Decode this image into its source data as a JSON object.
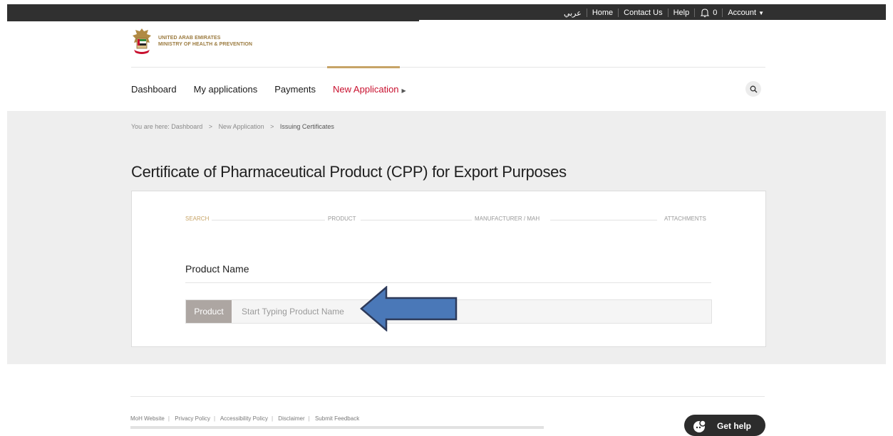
{
  "topbar": {
    "arabic": "عربي",
    "home": "Home",
    "contact": "Contact Us",
    "help": "Help",
    "notifications_count": "0",
    "account": "Account"
  },
  "logo": {
    "line1": "UNITED ARAB EMIRATES",
    "line2": "MINISTRY OF HEALTH & PREVENTION"
  },
  "nav": {
    "items": [
      {
        "label": "Dashboard"
      },
      {
        "label": "My applications"
      },
      {
        "label": "Payments"
      },
      {
        "label": "New Application"
      }
    ],
    "active_index": 3
  },
  "breadcrumb": {
    "prefix": "You are here:",
    "items": [
      "Dashboard",
      "New Application",
      "Issuing Certificates"
    ],
    "separator": ">"
  },
  "page": {
    "title": "Certificate of Pharmaceutical Product (CPP) for Export Purposes"
  },
  "steps": {
    "items": [
      "SEARCH",
      "PRODUCT",
      "MANUFACTURER / MAH",
      "ATTACHMENTS"
    ],
    "active_index": 0
  },
  "form": {
    "section_title": "Product Name",
    "field_label": "Product",
    "placeholder": "Start Typing Product Name",
    "value": ""
  },
  "footer": {
    "links": [
      "MoH Website",
      "Privacy Policy",
      "Accessibility Policy",
      "Disclaimer",
      "Submit Feedback"
    ]
  },
  "help_widget": {
    "label": "Get help"
  },
  "colors": {
    "accent_gold": "#c7a467",
    "active_red": "#c8102e",
    "topbar_bg": "#303030",
    "annotation_arrow": "#4a78b8"
  },
  "icons": {
    "search": "search-icon",
    "bell": "bell-icon",
    "chat": "chat-icon"
  }
}
